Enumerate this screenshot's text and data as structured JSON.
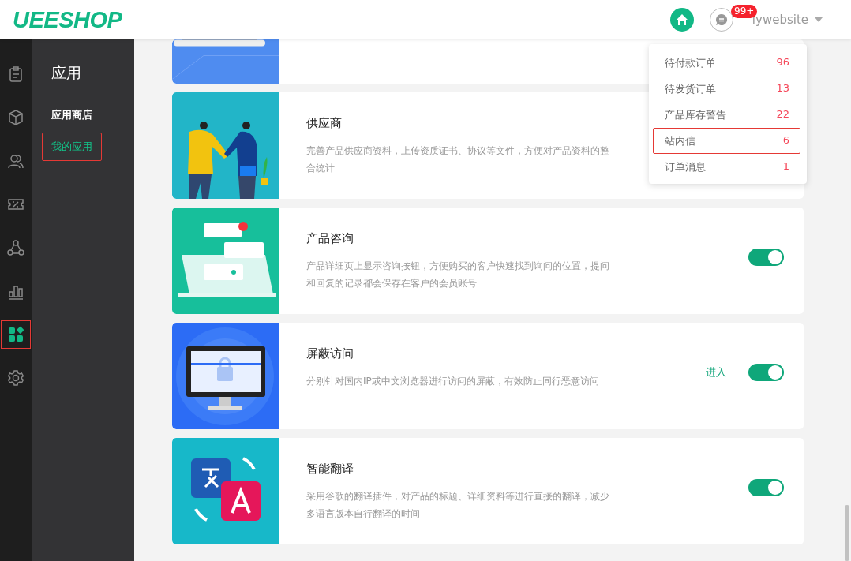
{
  "header": {
    "logo": "UEESHOP",
    "badge": "99+",
    "user": "lywebsite"
  },
  "rail": [
    {
      "kind": "clipboard",
      "selected": false
    },
    {
      "kind": "box",
      "selected": false
    },
    {
      "kind": "users",
      "selected": false
    },
    {
      "kind": "coupon",
      "selected": false
    },
    {
      "kind": "network",
      "selected": false
    },
    {
      "kind": "chart",
      "selected": false
    },
    {
      "kind": "apps",
      "selected": true
    },
    {
      "kind": "gear",
      "selected": false
    }
  ],
  "subnav": {
    "title": "应用",
    "items": [
      {
        "label": "应用商店",
        "selected": false
      },
      {
        "label": "我的应用",
        "selected": true
      }
    ]
  },
  "apps": [
    {
      "kind": "picture"
    },
    {
      "title": "供应商",
      "description": "完善产品供应商资料，上传资质证书、协议等文件，方便对产品资料的整合统计"
    },
    {
      "title": "产品咨询",
      "description": "产品详细页上显示咨询按钮，方便购买的客户快速找到询问的位置，提问和回复的记录都会保存在客户的会员账号",
      "on": true
    },
    {
      "title": "屏蔽访问",
      "description": "分别针对国内IP或中文浏览器进行访问的屏蔽，有效防止同行恶意访问",
      "enter": "进入",
      "on": true
    },
    {
      "title": "智能翻译",
      "description": "采用谷歌的翻译插件，对产品的标题、详细资料等进行直接的翻译，减少多语言版本自行翻译的时间",
      "on": true
    }
  ],
  "dropdown": [
    {
      "label": "待付款订单",
      "count": "96",
      "selected": false
    },
    {
      "label": "待发货订单",
      "count": "13",
      "selected": false
    },
    {
      "label": "产品库存警告",
      "count": "22",
      "selected": false
    },
    {
      "label": "站内信",
      "count": "6",
      "selected": true
    },
    {
      "label": "订单消息",
      "count": "1",
      "selected": false
    }
  ]
}
